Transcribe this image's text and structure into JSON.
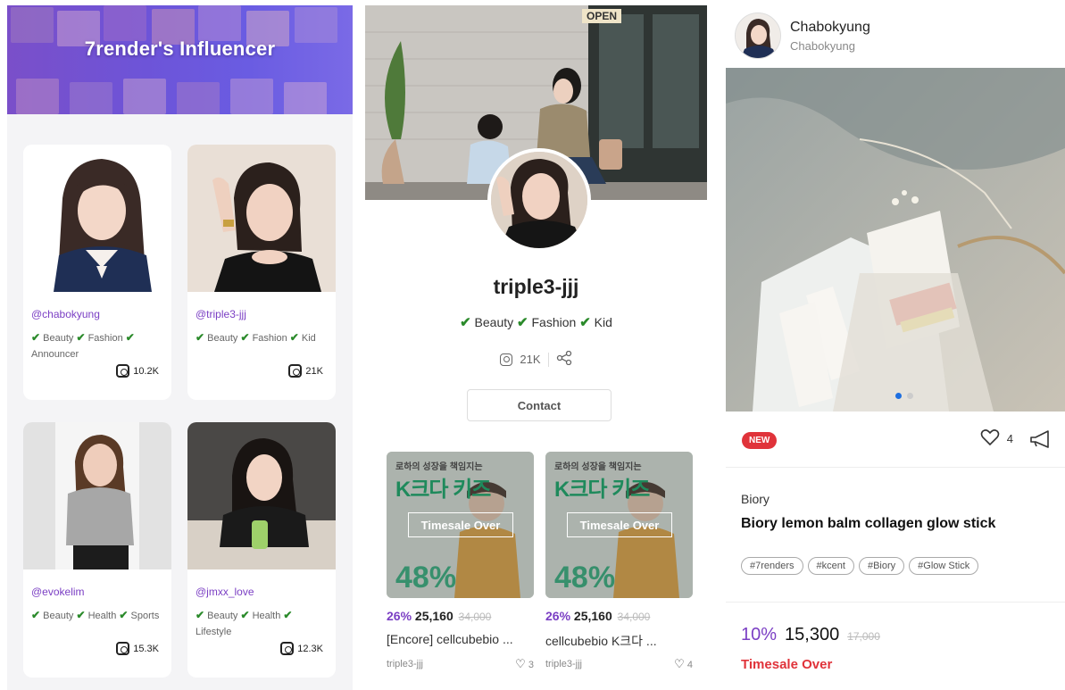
{
  "influencer_list": {
    "banner_title": "7render's Influencer",
    "cards": [
      {
        "handle": "@chabokyung",
        "tags": [
          "Beauty",
          "Fashion",
          "Announcer"
        ],
        "followers": "10.2K"
      },
      {
        "handle": "@triple3-jjj",
        "tags": [
          "Beauty",
          "Fashion",
          "Kid"
        ],
        "followers": "21K"
      },
      {
        "handle": "@evokelim",
        "tags": [
          "Beauty",
          "Health",
          "Sports"
        ],
        "followers": "15.3K"
      },
      {
        "handle": "@jmxx_love",
        "tags": [
          "Beauty",
          "Health",
          "Lifestyle"
        ],
        "followers": "12.3K"
      }
    ]
  },
  "profile": {
    "name": "triple3-jjj",
    "tags": [
      "Beauty",
      "Fashion",
      "Kid"
    ],
    "followers": "21K",
    "contact_label": "Contact",
    "products": [
      {
        "thumb_headline": "로하의 성장을 책임지는",
        "thumb_big": "K크다 키즈",
        "overlay": "Timesale Over",
        "thumb_pct": "48%",
        "discount": "26%",
        "price": "25,160",
        "original": "34,000",
        "title": "[Encore] cellcubebio ...",
        "seller": "triple3-jjj",
        "likes": "3"
      },
      {
        "thumb_headline": "로하의 성장을 책임지는",
        "thumb_big": "K크다 키즈",
        "overlay": "Timesale Over",
        "thumb_pct": "48%",
        "discount": "26%",
        "price": "25,160",
        "original": "34,000",
        "title": "cellcubebio K크다 ...",
        "seller": "triple3-jjj",
        "likes": "4"
      }
    ]
  },
  "post": {
    "author_name": "Chabokyung",
    "author_sub": "Chabokyung",
    "new_badge": "NEW",
    "likes": "4",
    "brand": "Biory",
    "title": "Biory lemon balm collagen glow stick",
    "hashtags": [
      "#7renders",
      "#kcent",
      "#Biory",
      "#Glow Stick"
    ],
    "discount": "10%",
    "price": "15,300",
    "original": "17,000",
    "status": "Timesale Over"
  },
  "colors": {
    "accent_purple": "#7b3fc4",
    "check_green": "#2a8a2a",
    "alert_red": "#e0333a",
    "carousel_dot": "#1e6fe0"
  }
}
